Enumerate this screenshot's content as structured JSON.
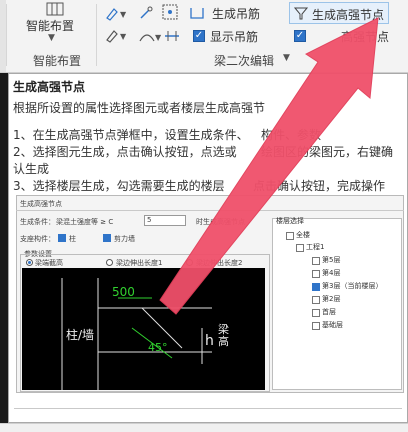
{
  "ribbon": {
    "smart_layout": "智能布置",
    "smart_layout_group": "智能布置",
    "gen_hanger": "生成吊筋",
    "show_hanger": "显示吊筋",
    "gen_node": "生成高强节点",
    "node_check_label": "高强节点",
    "beam_edit_group": "梁二次编辑"
  },
  "tooltip": {
    "title": "生成高强节点",
    "desc": "根据所设置的属性选择图元或者楼层生成高强节",
    "step1": "1、在生成高强节点弹框中，设置生成条件、",
    "step1_tail": "构件、参数",
    "step2": "2、选择图元生成，点击确认按钮，点选或",
    "step2_tail": "绘图区的梁图元，右键确",
    "step2_cont": "认生成",
    "step3": "3、选择楼层生成，勾选需要生成的楼层",
    "step3_tail": "点击确认按钮，完成操作"
  },
  "dialog": {
    "title": "生成高强节点",
    "gen_cond_label": "生成条件：",
    "gen_cond_value": "梁混土强度等 ≥ C",
    "gen_cond_input": "5",
    "gen_cond_tail": "时生成高强节点",
    "member_label": "支座构件：",
    "opt_col": "柱",
    "opt_wall": "剪力墙",
    "param_label": "参数设置",
    "radio1": "梁端截高",
    "radio2": "梁边伸出长度1",
    "radio3": "梁边伸出长度2",
    "cad_500": "500",
    "cad_45": "45°",
    "cad_h": "h",
    "cad_col": "柱/墙",
    "cad_beam": "梁高",
    "tree_title": "楼层选择",
    "tree_items": [
      "全楼",
      "工程1",
      "第5层",
      "第4层",
      "第3层（当前楼层）",
      "第2层",
      "首层",
      "基础层"
    ]
  },
  "colors": {
    "accent": "#2f74c9",
    "arrow": "#f0506a",
    "cad_green": "#31d12f"
  }
}
